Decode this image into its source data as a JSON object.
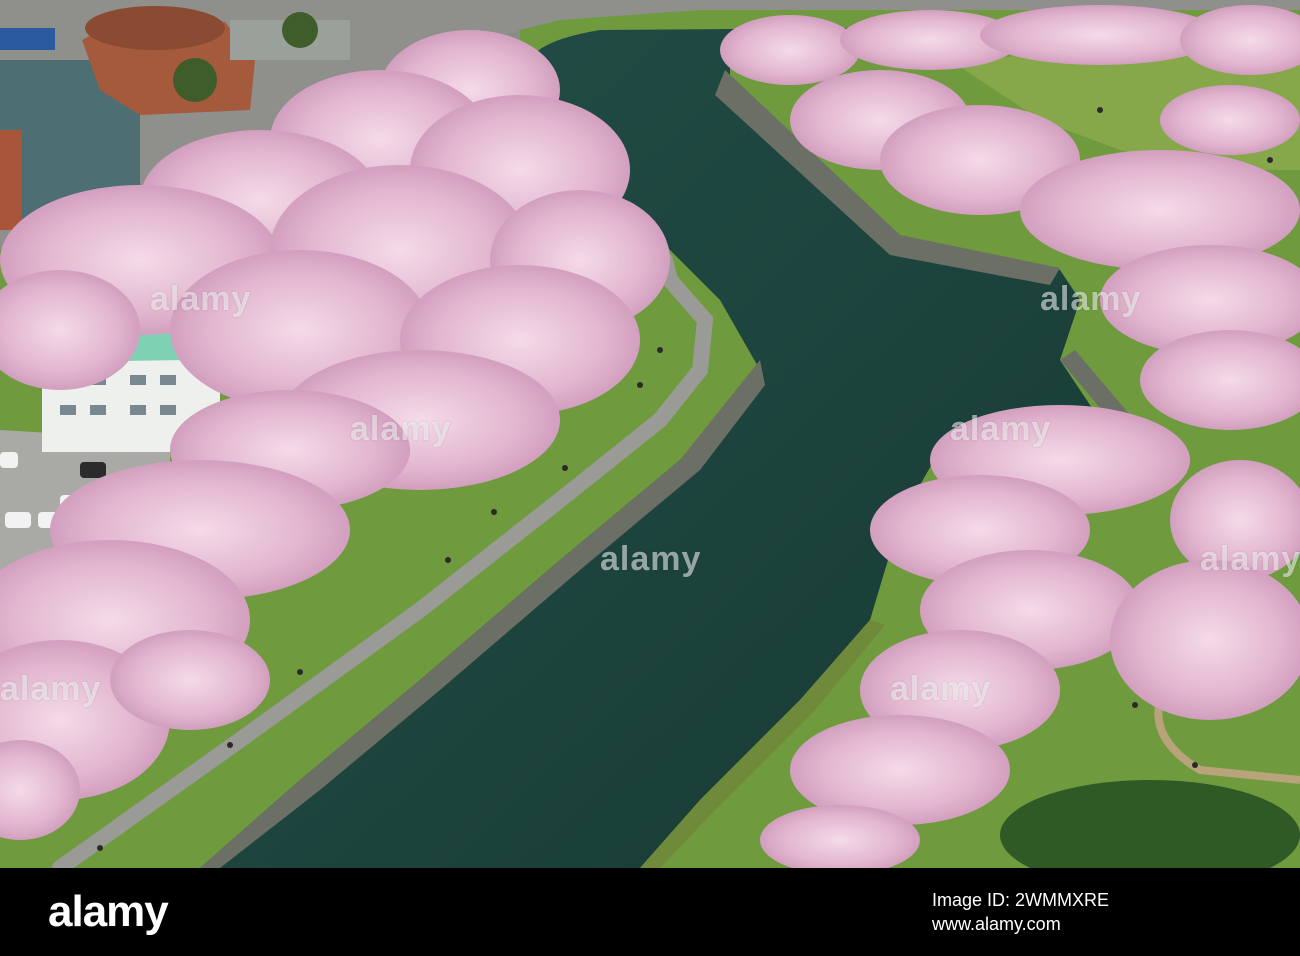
{
  "watermarks": [
    {
      "text": "alamy"
    },
    {
      "text": "alamy"
    },
    {
      "text": "alamy"
    },
    {
      "text": "alamy"
    },
    {
      "text": "alamy"
    },
    {
      "text": "alamy"
    },
    {
      "text": "alamy"
    },
    {
      "text": "alamy"
    }
  ],
  "footer": {
    "logo": "alamy",
    "image_id_line": "Image ID: 2WMMXRE",
    "site_line": "www.alamy.com"
  },
  "colors": {
    "water": "#1e4640",
    "grass": "#6f9a3e",
    "blossom": "#e6bfd6",
    "path": "#9a9a96",
    "stone_wall": "#6b6f66",
    "footer_bg": "#000000"
  }
}
